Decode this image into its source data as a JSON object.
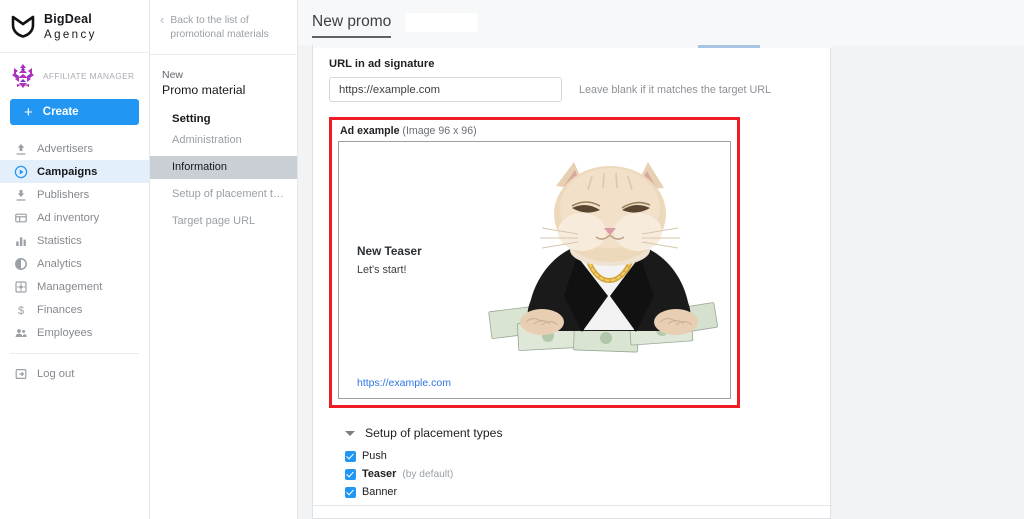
{
  "brand": {
    "logo_icon": "shield-crest-icon",
    "name_line1": "BigDeal",
    "name_line2": "Agency"
  },
  "account": {
    "avatar_icon": "geometric-avatar-icon",
    "role": "AFFILIATE MANAGER",
    "create_label": "Create",
    "create_plus": "+",
    "accent_color": "#2196f3"
  },
  "sidebar": {
    "items": [
      {
        "label": "Advertisers",
        "icon": "upload-arrow-icon",
        "active": false
      },
      {
        "label": "Campaigns",
        "icon": "play-circle-icon",
        "active": true
      },
      {
        "label": "Publishers",
        "icon": "download-arrow-icon",
        "active": false
      },
      {
        "label": "Ad inventory",
        "icon": "layout-panel-icon",
        "active": false
      },
      {
        "label": "Statistics",
        "icon": "bar-chart-icon",
        "active": false
      },
      {
        "label": "Analytics",
        "icon": "pie-chart-icon",
        "active": false
      },
      {
        "label": "Management",
        "icon": "gear-square-icon",
        "active": false
      },
      {
        "label": "Finances",
        "icon": "dollar-sign-icon",
        "active": false
      },
      {
        "label": "Employees",
        "icon": "people-icon",
        "active": false
      }
    ],
    "logout": {
      "label": "Log out",
      "icon": "logout-arrow-icon"
    }
  },
  "subnav": {
    "back_label": "Back to the list of promotional materials",
    "back_icon": "chevron-left-icon",
    "title_line1": "New",
    "title_line2": "Promo material",
    "group_label": "Setting",
    "items": [
      {
        "label": "Administration",
        "active": false
      },
      {
        "label": "Information",
        "active": true
      },
      {
        "label": "Setup of placement t…",
        "active": false
      },
      {
        "label": "Target page URL",
        "active": false
      }
    ]
  },
  "header": {
    "title": "New promo",
    "redacted_block": ""
  },
  "form": {
    "url_label": "URL in ad signature",
    "url_value": "https://example.com",
    "url_placeholder": "https://example.com",
    "url_hint": "Leave blank if it matches the target URL"
  },
  "ad_example": {
    "caption_bold": "Ad example",
    "caption_note": "(Image 96 x 96)",
    "highlight_color": "#ee1c25",
    "headline": "New Teaser",
    "subtext": "Let's start!",
    "link": "https://example.com",
    "art_icon": "cat-in-suit-with-money-image"
  },
  "placements": {
    "title": "Setup of placement types",
    "caret_icon": "chevron-down-icon",
    "options": [
      {
        "label": "Push",
        "note": "",
        "checked": true,
        "bold": false
      },
      {
        "label": "Teaser",
        "note": "(by default)",
        "checked": true,
        "bold": true
      },
      {
        "label": "Banner",
        "note": "",
        "checked": true,
        "bold": false
      }
    ]
  }
}
